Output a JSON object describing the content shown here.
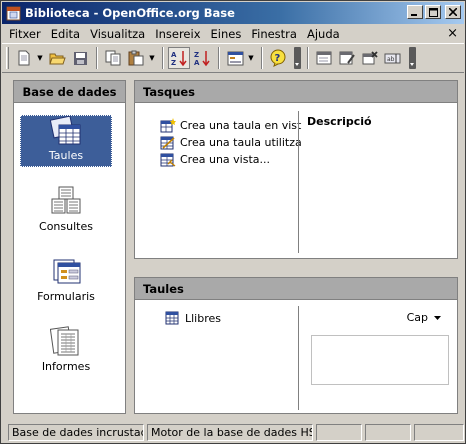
{
  "window": {
    "title": "Biblioteca - OpenOffice.org Base",
    "icon": "database-app-icon",
    "controls": {
      "minimize": "_",
      "maximize": "□",
      "close": "×"
    }
  },
  "menubar": {
    "items": [
      "Fitxer",
      "Edita",
      "Visualitza",
      "Insereix",
      "Eines",
      "Finestra",
      "Ajuda"
    ],
    "close_glyph": "×"
  },
  "toolbar": {
    "icons": [
      "new-document-icon",
      "open-folder-icon",
      "save-icon",
      "copy-icon",
      "paste-icon",
      "sort-ascending-icon",
      "sort-descending-icon",
      "form-icon",
      "help-icon",
      "open-object-icon",
      "edit-object-icon",
      "delete-object-icon",
      "rename-object-icon"
    ]
  },
  "left_panel": {
    "header": "Base de dades",
    "items": [
      {
        "label": "Taules",
        "icon": "tables-icon",
        "selected": true
      },
      {
        "label": "Consultes",
        "icon": "queries-icon",
        "selected": false
      },
      {
        "label": "Formularis",
        "icon": "forms-icon",
        "selected": false
      },
      {
        "label": "Informes",
        "icon": "reports-icon",
        "selected": false
      }
    ]
  },
  "tasks_panel": {
    "header": "Tasques",
    "items": [
      {
        "label": "Crea una taula en vist",
        "icon": "table-design-icon"
      },
      {
        "label": "Crea una taula utilitza",
        "icon": "table-wizard-icon"
      },
      {
        "label": "Crea una vista...",
        "icon": "create-view-icon"
      }
    ],
    "description_label": "Descripció"
  },
  "tables_panel": {
    "header": "Taules",
    "items": [
      {
        "label": "Llibres",
        "icon": "table-icon"
      }
    ],
    "preview_select": "Cap"
  },
  "statusbar": {
    "cells": [
      "Base de dades incrustada",
      "Motor de la base de dades HSQL",
      "",
      "",
      ""
    ]
  },
  "colors": {
    "title_gradient_start": "#0a246a",
    "title_gradient_end": "#a6caf0",
    "panel_header": "#a9a9a9",
    "selection": "#3d5e99",
    "window_bg": "#d4d0c8"
  }
}
